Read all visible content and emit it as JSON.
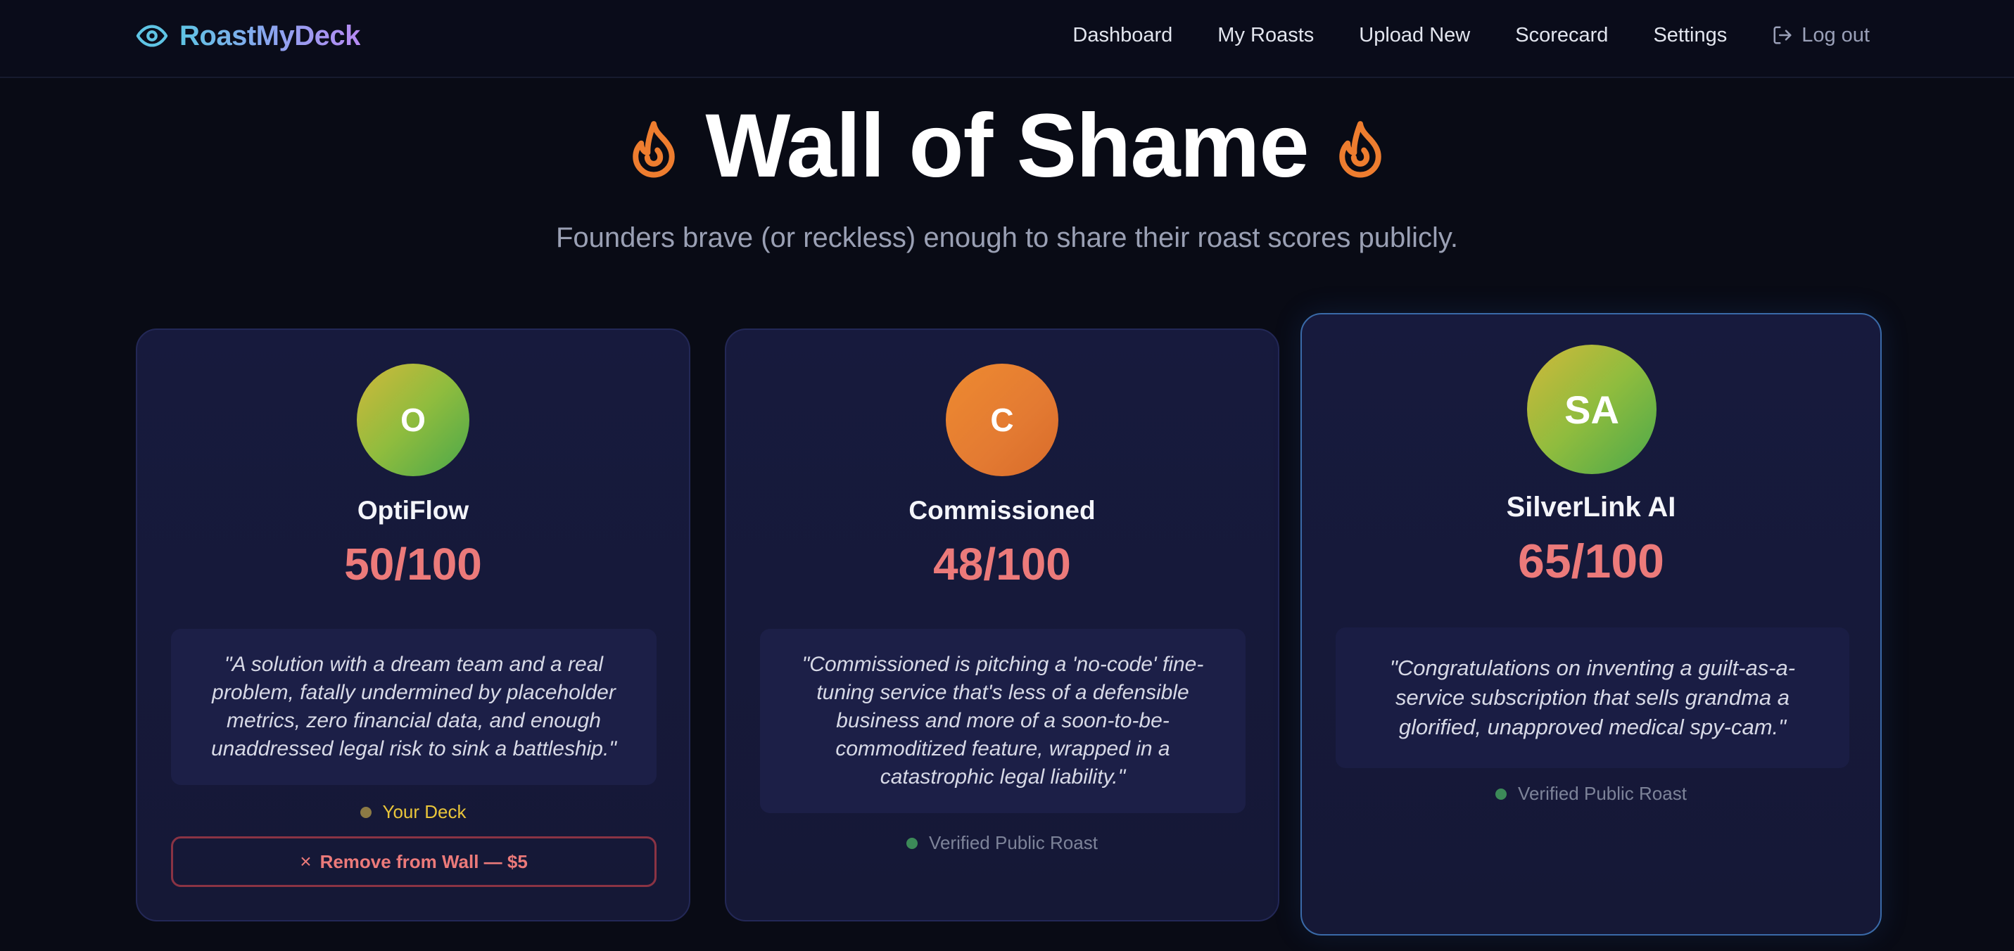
{
  "brand": {
    "name": "RoastMyDeck",
    "icon": "eye-icon"
  },
  "nav": {
    "links": [
      "Dashboard",
      "My Roasts",
      "Upload New",
      "Scorecard",
      "Settings"
    ],
    "logout_label": "Log out"
  },
  "hero": {
    "title": "Wall of Shame",
    "subtitle": "Founders brave (or reckless) enough to share their roast scores publicly.",
    "icon": "flame-icon"
  },
  "cards": [
    {
      "initials": "O",
      "name": "OptiFlow",
      "score": "50/100",
      "quote": "\"A solution with a dream team and a real problem, fatally undermined by placeholder metrics, zero financial data, and enough unaddressed legal risk to sink a battleship.\"",
      "tag": "Your Deck",
      "remove_label": "Remove from Wall — $5",
      "remove_icon": "×"
    },
    {
      "initials": "C",
      "name": "Commissioned",
      "score": "48/100",
      "quote": "\"Commissioned is pitching a 'no-code' fine-tuning service that's less of a defensible business and more of a soon-to-be-commoditized feature, wrapped in a catastrophic legal liability.\"",
      "tag": "Verified Public Roast"
    },
    {
      "initials": "SA",
      "name": "SilverLink AI",
      "score": "65/100",
      "quote": "\"Congratulations on inventing a guilt-as-a-service subscription that sells grandma a glorified, unapproved medical spy-cam.\"",
      "tag": "Verified Public Roast"
    }
  ],
  "colors": {
    "background": "#090b15",
    "card": "#171a3d",
    "score": "#ec7a7a",
    "flame": "#ee7d2f",
    "highlight_border": "#3a6aa8"
  }
}
